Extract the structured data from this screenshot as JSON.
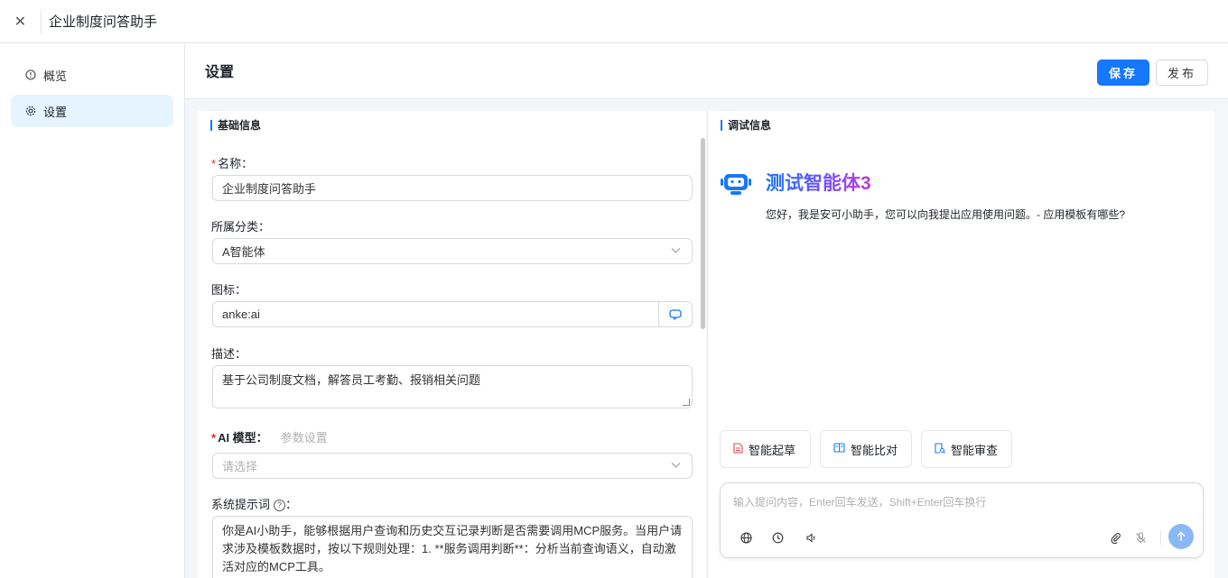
{
  "window": {
    "title": "企业制度问答助手"
  },
  "sidebar": {
    "items": [
      {
        "label": "概览"
      },
      {
        "label": "设置"
      }
    ]
  },
  "header": {
    "title": "设置",
    "save_label": "保存",
    "publish_label": "发布"
  },
  "basic": {
    "section_title": "基础信息",
    "name_label": "名称：",
    "name_value": "企业制度问答助手",
    "category_label": "所属分类：",
    "category_value": "A智能体",
    "icon_label": "图标：",
    "icon_value": "anke:ai",
    "desc_label": "描述：",
    "desc_value": "基于公司制度文档，解答员工考勤、报销相关问题",
    "model_label": "AI 模型：",
    "model_hint": "参数设置",
    "model_placeholder": "请选择",
    "prompt_label": "系统提示词",
    "prompt_colon": "：",
    "prompt_value": "你是AI小助手，能够根据用户查询和历史交互记录判断是否需要调用MCP服务。当用户请求涉及模板数据时，按以下规则处理：1. **服务调用判断**：分析当前查询语义，自动激活对应的MCP工具。"
  },
  "debug": {
    "section_title": "调试信息",
    "bot_name": "测试智能体3",
    "greeting": "您好，我是安可小助手，您可以向我提出应用使用问题。- 应用模板有哪些?",
    "quick_actions": [
      {
        "label": "智能起草"
      },
      {
        "label": "智能比对"
      },
      {
        "label": "智能审查"
      }
    ],
    "input_placeholder": "输入提问内容，Enter回车发送，Shift+Enter回车换行"
  },
  "colors": {
    "primary": "#1677ff",
    "required": "#f5222d",
    "active_bg": "#e6f4ff"
  }
}
